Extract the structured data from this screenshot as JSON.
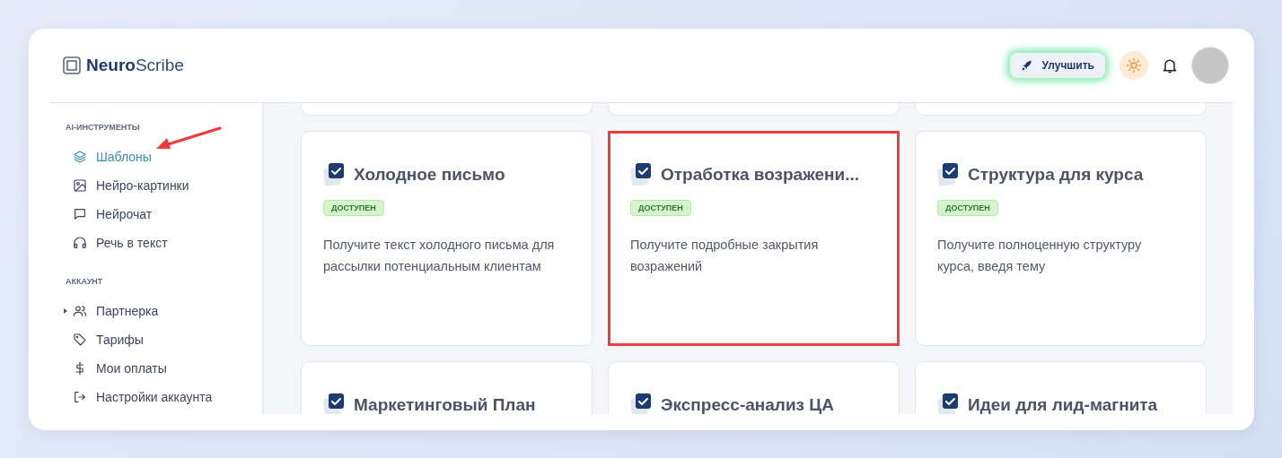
{
  "brand": {
    "bold": "Neuro",
    "regular": "Scribe"
  },
  "header": {
    "upgrade_label": "Улучшить"
  },
  "sidebar": {
    "sections": [
      {
        "title": "AI-ИНСТРУМЕНТЫ",
        "items": [
          {
            "label": "Шаблоны",
            "kind": "layers",
            "selected": true
          },
          {
            "label": "Нейро-картинки",
            "kind": "image",
            "selected": false
          },
          {
            "label": "Нейрочат",
            "kind": "chat",
            "selected": false
          },
          {
            "label": "Речь в текст",
            "kind": "headphones",
            "selected": false
          }
        ]
      },
      {
        "title": "АККАУНТ",
        "items": [
          {
            "label": "Партнерка",
            "kind": "users",
            "selected": false,
            "expanded": false
          },
          {
            "label": "Тарифы",
            "kind": "tag",
            "selected": false
          },
          {
            "label": "Мои оплаты",
            "kind": "dollar",
            "selected": false
          },
          {
            "label": "Настройки аккаунта",
            "kind": "exit",
            "selected": false
          }
        ]
      }
    ]
  },
  "cards": [
    {
      "title": "Холодное письмо",
      "badge": "ДОСТУПЕН",
      "description": "Получите текст холодного письма для рассылки потенциальным клиентам",
      "highlighted": false
    },
    {
      "title": "Отработка возражени...",
      "badge": "ДОСТУПЕН",
      "description": "Получите подробные закрытия возражений",
      "highlighted": true
    },
    {
      "title": "Структура для курса",
      "badge": "ДОСТУПЕН",
      "description": "Получите полноценную структуру курса, введя тему",
      "highlighted": false
    },
    {
      "title": "Маркетинговый План",
      "highlighted": false
    },
    {
      "title": "Экспресс-анализ ЦА",
      "highlighted": false
    },
    {
      "title": "Идеи для лид-магнита",
      "highlighted": false
    }
  ]
}
